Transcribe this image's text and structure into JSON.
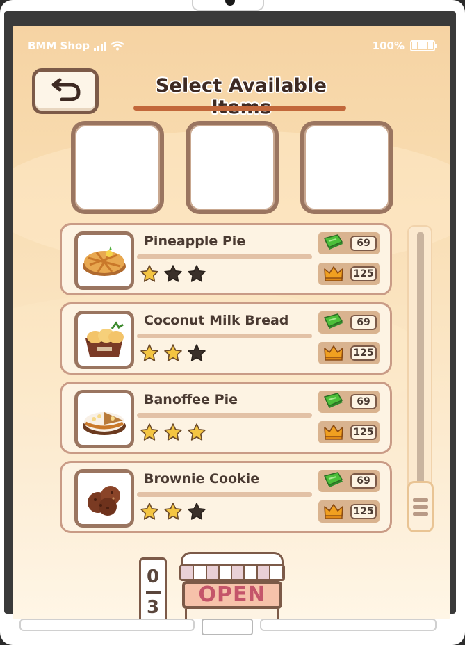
{
  "status_bar": {
    "carrier": "BMM Shop",
    "battery": "100%"
  },
  "header": {
    "title": "Select Available Items",
    "back_icon": "undo-arrow-icon"
  },
  "selected_slots": [
    {
      "empty": true
    },
    {
      "empty": true
    },
    {
      "empty": true
    }
  ],
  "items": [
    {
      "name": "Pineapple Pie",
      "cash": "69",
      "crowns": "125",
      "stars_filled": 1,
      "stars_total": 3,
      "image": "pineapple-pie-icon"
    },
    {
      "name": "Coconut Milk Bread",
      "cash": "69",
      "crowns": "125",
      "stars_filled": 2,
      "stars_total": 3,
      "image": "coconut-milk-bread-icon"
    },
    {
      "name": "Banoffee Pie",
      "cash": "69",
      "crowns": "125",
      "stars_filled": 3,
      "stars_total": 3,
      "image": "banoffee-pie-icon"
    },
    {
      "name": "Brownie Cookie",
      "cash": "69",
      "crowns": "125",
      "stars_filled": 2,
      "stars_total": 3,
      "image": "brownie-cookie-icon"
    }
  ],
  "counter": {
    "current": "0",
    "max": "3"
  },
  "shop_button": {
    "label": "OPEN"
  },
  "colors": {
    "frame_brown": "#7c5a48",
    "accent_orange": "#c2673a",
    "cash_green": "#4cbf3a",
    "crown_orange": "#f0a020",
    "star_gold": "#f4c542",
    "star_dark": "#3a302a",
    "open_text": "#c4556a"
  }
}
